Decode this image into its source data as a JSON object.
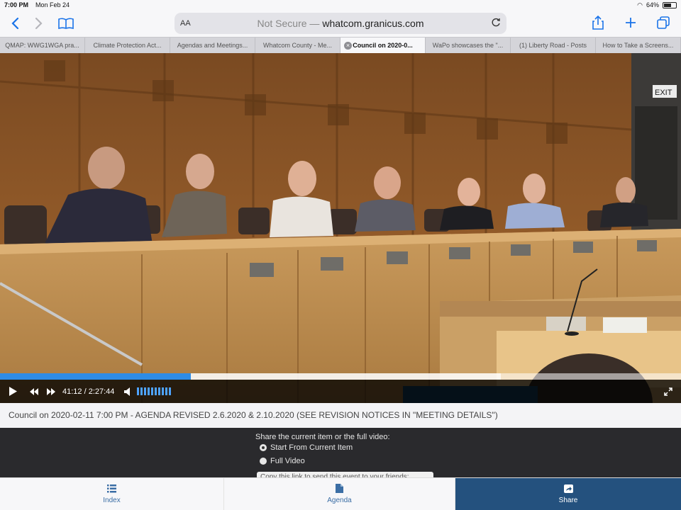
{
  "status": {
    "time": "7:00 PM",
    "date": "Mon Feb 24",
    "battery": "64%",
    "battery_level": 0.64
  },
  "toolbar": {
    "text_size": "AA",
    "security": "Not Secure —",
    "domain": "whatcom.granicus.com",
    "icons": [
      "back-icon",
      "forward-icon",
      "bookmarks-icon",
      "reload-icon",
      "share-icon",
      "new-tab-icon",
      "tabs-icon"
    ]
  },
  "tabs": [
    {
      "label": "QMAP: WWG1WGA pra..."
    },
    {
      "label": "Climate Protection Act..."
    },
    {
      "label": "Agendas and Meetings..."
    },
    {
      "label": "Whatcom County - Me..."
    },
    {
      "label": "Council on 2020-0..."
    },
    {
      "label": "WaPo showcases the \"..."
    },
    {
      "label": "(1) Liberty Road - Posts"
    },
    {
      "label": "How to Take a Screens..."
    }
  ],
  "video": {
    "scene_text": {
      "exit_sign": "EXIT"
    },
    "progress_fraction": 0.28,
    "loaded_fraction": 0.735,
    "timecode": "41:12 / 2:27:44",
    "volume_level": 1.0
  },
  "video_title": "Council on 2020-02-11 7:00 PM - AGENDA REVISED 2.6.2020 & 2.10.2020 (SEE REVISION NOTICES IN \"MEETING DETAILS\")",
  "share": {
    "prompt": "Share the current item or the full video:",
    "options": [
      {
        "label": "Start From Current Item",
        "selected": true
      },
      {
        "label": "Full Video",
        "selected": false
      }
    ],
    "link_text": "Copy this link to send this event to your friends:"
  },
  "bottom_tabs": [
    {
      "label": "Index",
      "icon": "list-icon"
    },
    {
      "label": "Agenda",
      "icon": "document-icon"
    },
    {
      "label": "Share",
      "icon": "share-icon",
      "active": true
    }
  ]
}
